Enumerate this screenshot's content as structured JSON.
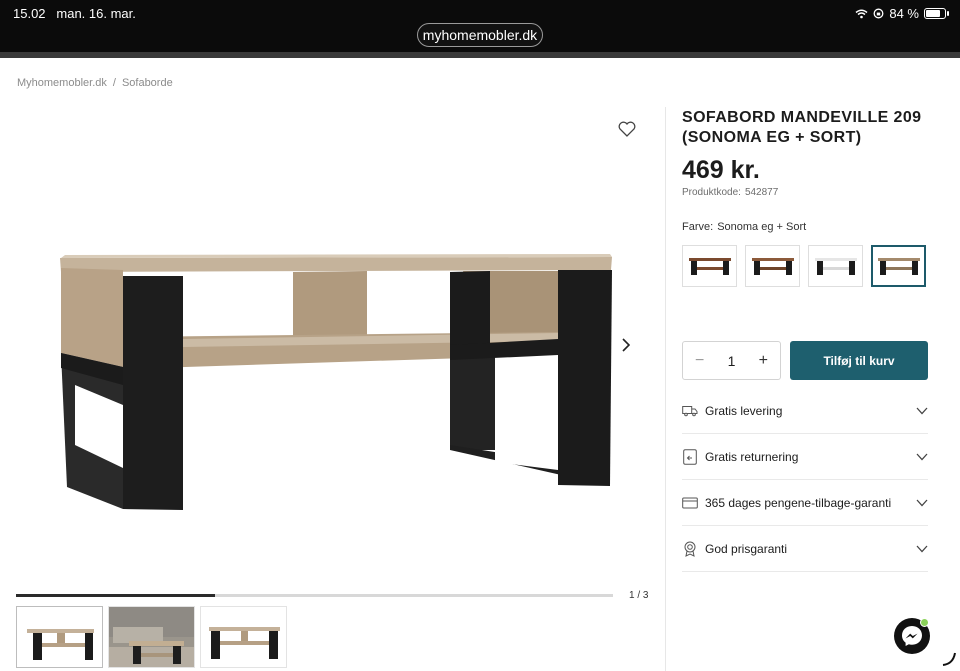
{
  "status_bar": {
    "time": "15.02",
    "date": "man. 16. mar.",
    "url": "myhomemobler.dk",
    "battery": "84 %"
  },
  "breadcrumb": {
    "items": [
      "Myhomemobler.dk",
      "Sofaborde"
    ],
    "separator": "/"
  },
  "gallery": {
    "pager": "1 / 3",
    "progress": 0.333,
    "thumbnails": [
      "thumb-1",
      "thumb-2",
      "thumb-3"
    ]
  },
  "product": {
    "title": "SOFABORD MANDEVILLE 209 (SONOMA EG + SORT)",
    "price": "469 kr.",
    "code_label": "Produktkode:",
    "code_value": "542877",
    "color_label": "Farve:",
    "color_value": "Sonoma eg + Sort",
    "swatch_count": 4,
    "selected_swatch": 4
  },
  "cart": {
    "minus": "−",
    "quantity": "1",
    "plus": "+",
    "add_label": "Tilføj til kurv"
  },
  "accordion": [
    {
      "label": "Gratis levering",
      "icon": "truck-icon"
    },
    {
      "label": "Gratis returnering",
      "icon": "return-icon"
    },
    {
      "label": "365 dages pengene-tilbage-garanti",
      "icon": "credit-card-icon"
    },
    {
      "label": "God prisgaranti",
      "icon": "award-icon"
    }
  ],
  "colors": {
    "accent": "#1e5f6e",
    "wood": "#b9a48a",
    "black": "#1b1b1b"
  }
}
